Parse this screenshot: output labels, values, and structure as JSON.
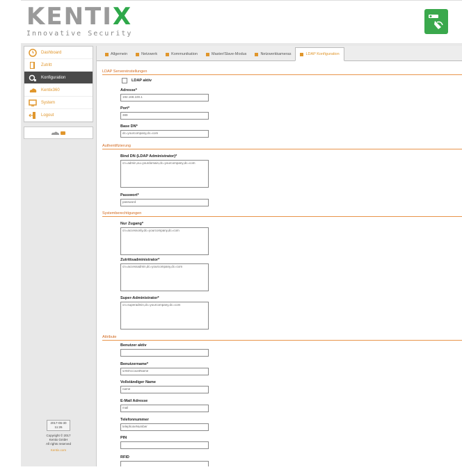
{
  "brand": {
    "logo_text": "KENTIX",
    "tagline": "Innovative Security"
  },
  "icons": {
    "app": "key-card-icon",
    "cloud": "cloud-icon"
  },
  "colors": {
    "accent": "#e0962c",
    "section": "#d2691e",
    "brand_green": "#3aa84c"
  },
  "sidebar": {
    "items": [
      {
        "label": "Dashboard",
        "icon": "clock-icon"
      },
      {
        "label": "Zutritt",
        "icon": "door-icon"
      },
      {
        "label": "Konfiguration",
        "icon": "settings-icon"
      },
      {
        "label": "Kentix360",
        "icon": "cloud-icon"
      },
      {
        "label": "System",
        "icon": "monitor-icon"
      },
      {
        "label": "Logout",
        "icon": "logout-icon"
      }
    ]
  },
  "footer": {
    "datetime_line1": "2017-06-30",
    "datetime_line2": "11:26",
    "copyright": "Copyright © 2017",
    "company": "Kentix GmbH",
    "rights": "All rights reserved",
    "link": "Kentix.com"
  },
  "tabs": [
    {
      "label": "Allgemein"
    },
    {
      "label": "Netzwerk"
    },
    {
      "label": "Kommunikation"
    },
    {
      "label": "Master/Slave-Modus"
    },
    {
      "label": "Netzwerkkameras"
    },
    {
      "label": "LDAP Konfiguration"
    }
  ],
  "sections": {
    "server": "LDAP Servereinstellungen",
    "auth": "Authentifizierung",
    "sysperm": "Systemberechtigungen",
    "attr": "Attribute"
  },
  "fields": {
    "ldap_active": {
      "label": "LDAP aktiv"
    },
    "address": {
      "label": "Adresse*",
      "value": "192.168.100.1"
    },
    "port": {
      "label": "Port*",
      "value": "389"
    },
    "base_dn": {
      "label": "Base DN*",
      "value": "dc=yourcompany,dc=com"
    },
    "bind_dn": {
      "label": "Bind DN (LDAP Administrator)*",
      "value": "cn=admin,ou=yourdomain,dc=yourcompany,dc=com"
    },
    "password": {
      "label": "Passwort*",
      "value": "password"
    },
    "access_only": {
      "label": "Nur Zugang*",
      "value": "cn=accessonly,dc=yourcompany,dc=com"
    },
    "access_admin": {
      "label": "Zutrittsadministrator*",
      "value": "cn=accessadmin,dc=yourcompany,dc=com"
    },
    "super_admin": {
      "label": "Super-Administrator*",
      "value": "cn=superadmin,dc=yourcompany,dc=com"
    },
    "user_active": {
      "label": "Benutzer aktiv",
      "value": ""
    },
    "username": {
      "label": "Benutzername*",
      "value": "sAMAccountName"
    },
    "fullname": {
      "label": "Vollständiger Name",
      "value": "name"
    },
    "email": {
      "label": "E-Mail Adresse",
      "value": "mail"
    },
    "phone": {
      "label": "Telefonnummer",
      "value": "telephoneNumber"
    },
    "pin": {
      "label": "PIN",
      "value": ""
    },
    "rfid": {
      "label": "RFID",
      "value": ""
    }
  }
}
